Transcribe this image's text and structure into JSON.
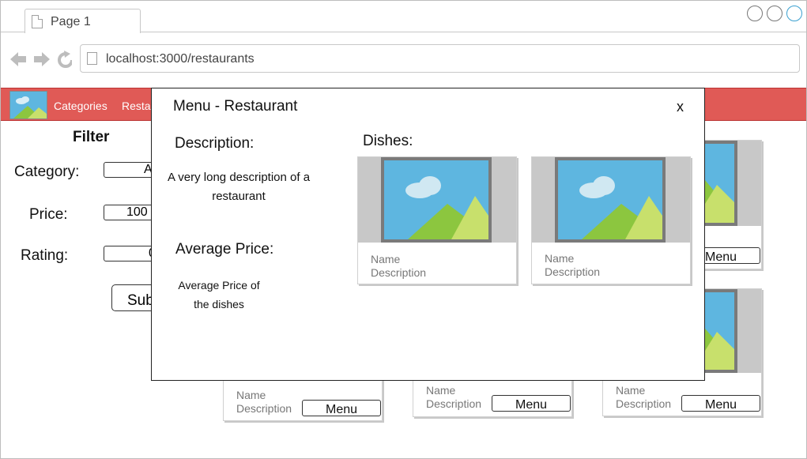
{
  "browser": {
    "tab_title": "Page 1",
    "url": "localhost:3000/restaurants"
  },
  "navbar": {
    "links": [
      "Categories",
      "Resta"
    ]
  },
  "filter": {
    "title": "Filter",
    "category_label": "Category:",
    "category_value": "A",
    "price_label": "Price:",
    "price_value": "100",
    "rating_label": "Rating:",
    "rating_value": "0",
    "submit_label": "Sub"
  },
  "restaurant_cards": [
    {
      "name": "Name",
      "description": "Description",
      "menu_label": "Menu"
    },
    {
      "name": "Name",
      "description": "Description",
      "menu_label": "Menu"
    },
    {
      "name": "Name",
      "description": "Description",
      "menu_label": "Menu"
    },
    {
      "name": "",
      "description": "",
      "menu_label": "Menu"
    },
    {
      "name": "",
      "description": "",
      "menu_label": ""
    }
  ],
  "modal": {
    "title": "Menu - Restaurant",
    "close_label": "x",
    "description_heading": "Description:",
    "description_text_line1": "A very long description of a",
    "description_text_line2": "restaurant",
    "avg_price_heading": "Average Price:",
    "avg_price_text_line1": "Average Price of",
    "avg_price_text_line2": "the dishes",
    "dishes_heading": "Dishes:",
    "dishes": [
      {
        "name": "Name",
        "description": "Description"
      },
      {
        "name": "Name",
        "description": "Description"
      }
    ]
  },
  "colors": {
    "navbar": "#e05a56",
    "image_sky": "#5eb6e0",
    "image_hill_dark": "#8cc63f",
    "image_hill_light": "#c8e06c",
    "image_frame": "#7a7a7a"
  },
  "icons": [
    "page-icon",
    "back-arrow-icon",
    "forward-arrow-icon",
    "reload-icon",
    "image-placeholder-icon"
  ]
}
